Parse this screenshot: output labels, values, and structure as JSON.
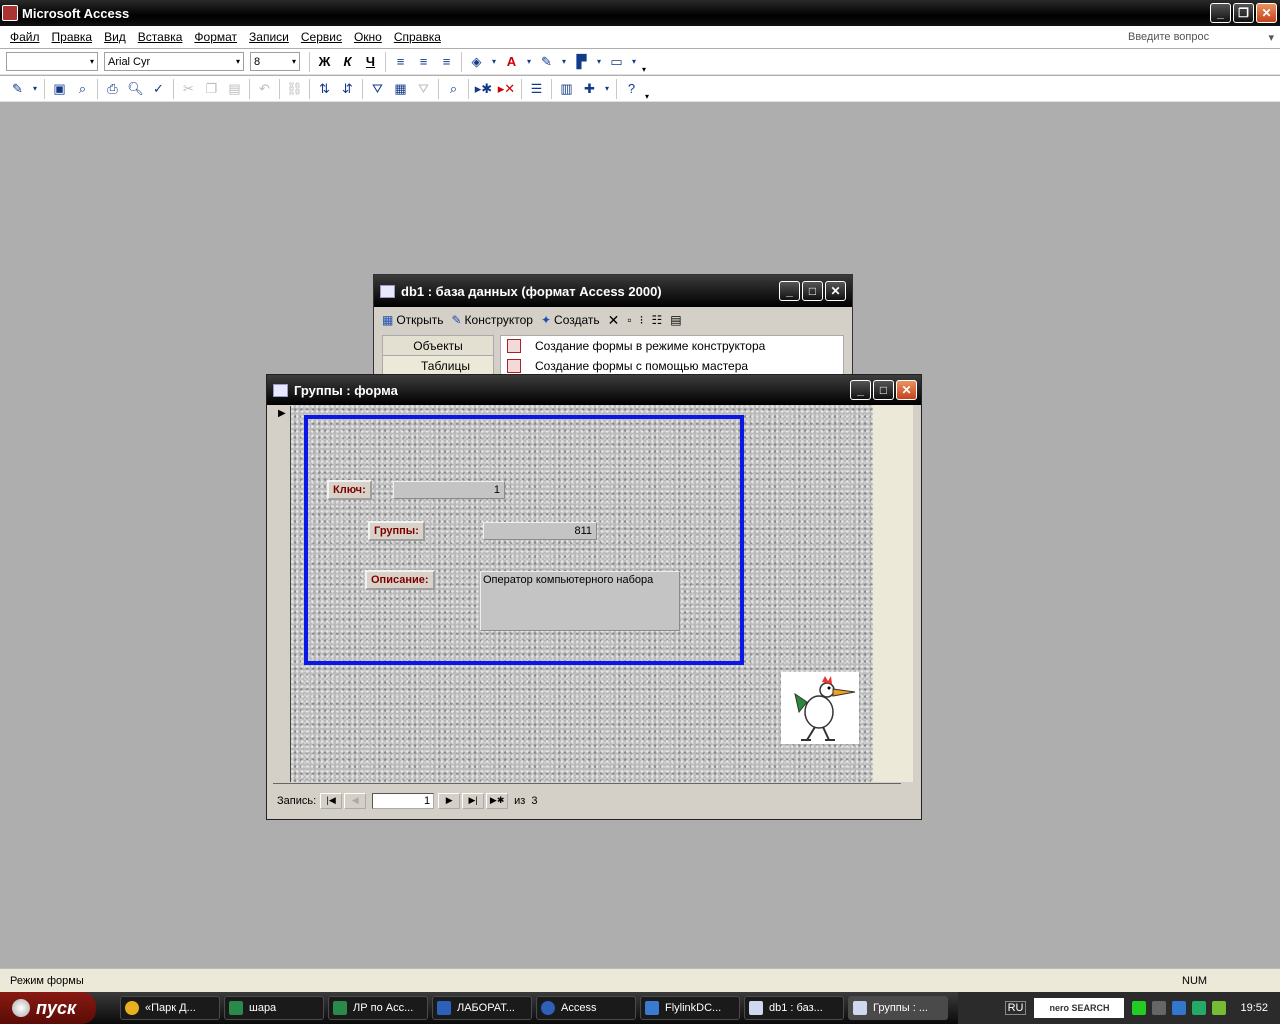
{
  "app": {
    "title": "Microsoft Access"
  },
  "menu": [
    "Файл",
    "Правка",
    "Вид",
    "Вставка",
    "Формат",
    "Записи",
    "Сервис",
    "Окно",
    "Справка"
  ],
  "help_placeholder": "Введите вопрос",
  "format_toolbar": {
    "object_combo": "",
    "font": "Arial Cyr",
    "size": "8",
    "bold": "Ж",
    "italic": "К",
    "underline": "Ч"
  },
  "db_window": {
    "title": "db1 : база данных (формат Access 2000)",
    "toolbar": [
      "Открыть",
      "Конструктор",
      "Создать"
    ],
    "objects_header": "Объекты",
    "tables_item": "Таблицы",
    "list": [
      "Создание формы в режиме конструктора",
      "Создание формы с помощью мастера"
    ]
  },
  "form": {
    "title": "Группы : форма",
    "fields": {
      "key_label": "Ключ:",
      "key_value": "1",
      "group_label": "Группы:",
      "group_value": "811",
      "desc_label": "Описание:",
      "desc_value": "Оператор компьютерного набора"
    },
    "nav": {
      "label": "Запись:",
      "current": "1",
      "of_label": "из",
      "total": "3"
    }
  },
  "status": {
    "mode": "Режим формы",
    "num": "NUM"
  },
  "taskbar": {
    "start": "пуск",
    "tasks": [
      "«Парк Д...",
      "шара",
      "ЛР по Acc...",
      "ЛАБОРАТ...",
      "Access",
      "FlylinkDC...",
      "db1 : баз...",
      "Группы : ..."
    ],
    "lang": "RU",
    "nero": "nero SEARCH",
    "clock": "19:52"
  },
  "colors": {
    "accent_border": "#0a17e6",
    "label_text": "#7d0000"
  }
}
